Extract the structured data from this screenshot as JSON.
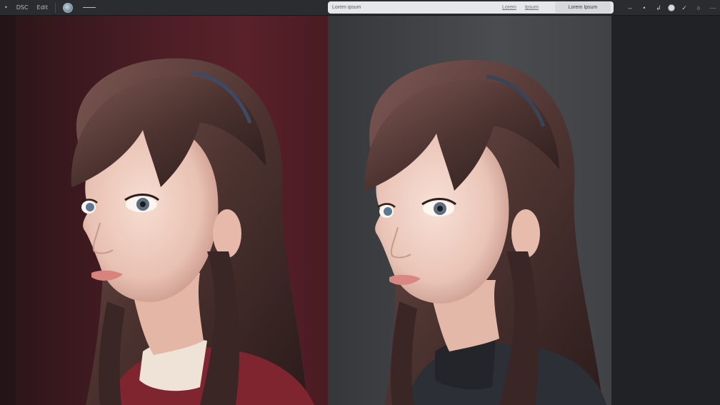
{
  "toolbar": {
    "left_buttons": [
      "DSC",
      "Edit"
    ],
    "search": {
      "placeholder": "Lorem ipsum",
      "links": [
        "Lorem",
        "Ipsum"
      ],
      "action_label": "Lorem Ipsum"
    },
    "right_icons": [
      "minus-icon",
      "dot-icon",
      "share-icon",
      "avatar-icon",
      "check-icon",
      "circle-icon",
      "more-icon"
    ]
  },
  "panels": {
    "left": {
      "subject": "portrait-red-sweater",
      "background": "#4a1d24",
      "sweater_color": "#8e2a33"
    },
    "right": {
      "subject": "portrait-dark-sweater",
      "background": "#45474a",
      "sweater_color": "#2c2f36"
    }
  },
  "colors": {
    "toolbar_bg": "#2a2c30",
    "hair": "#5a3d38",
    "skin": "#f1d3c6"
  }
}
